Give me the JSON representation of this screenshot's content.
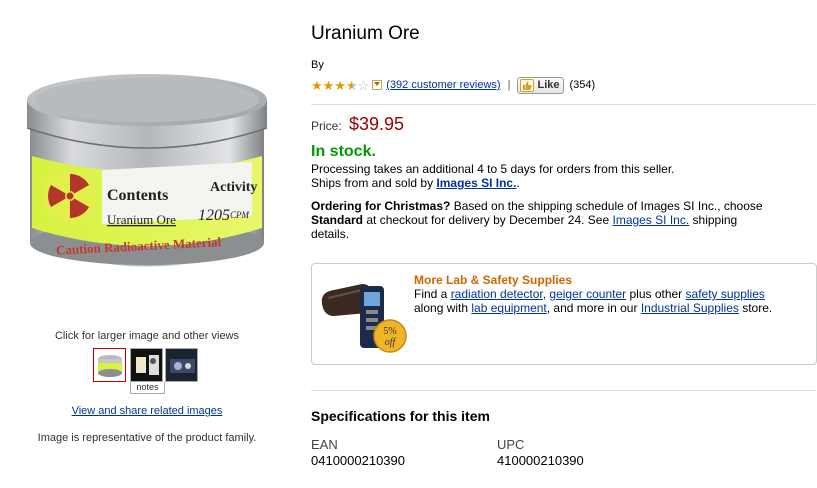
{
  "left": {
    "click_hint": "Click for larger image and other views",
    "thumbnail_note": "notes",
    "view_share": "View and share related images",
    "representative": "Image is representative of the product family.",
    "tin_label": {
      "contents": "Contents",
      "activity": "Activity",
      "item": "Uranium Ore",
      "cpm": "1205",
      "cpm_unit": "CPM",
      "caution": "Caution Radioactive Material"
    }
  },
  "product": {
    "title": "Uranium Ore",
    "by": "By",
    "rating_stars": 3.5,
    "reviews_link": "(392 customer reviews)",
    "separator": "|",
    "like_label": "Like",
    "like_count": "(354)",
    "price_label": "Price:",
    "price_value": "$39.95",
    "stock": "In stock.",
    "processing": "Processing takes an additional 4 to 5 days for orders from this seller.",
    "ships_prefix": "Ships from and sold by ",
    "seller": "Images SI Inc.",
    "ships_suffix": ".",
    "christmas_label": "Ordering for Christmas?",
    "christmas_text1": " Based on the shipping schedule of Images SI Inc., choose",
    "standard_label": "Standard",
    "christmas_text2": " at checkout for delivery by December 24. See ",
    "christmas_seller": "Images SI Inc.",
    "christmas_text3": " shipping",
    "christmas_text4": "details."
  },
  "promo": {
    "title": "More Lab & Safety Supplies",
    "text1": "Find a ",
    "link1": "radiation detector",
    "text2": ", ",
    "link2": "geiger counter",
    "text3": " plus other ",
    "link3": "safety supplies",
    "text4": "along with ",
    "link4": "lab equipment",
    "text5": ", and more in our ",
    "link5": "Industrial Supplies",
    "text6": " store.",
    "badge_percent": "5%",
    "badge_off": "off"
  },
  "specs": {
    "title": "Specifications for this item",
    "items": [
      {
        "label": "EAN",
        "value": "0410000210390"
      },
      {
        "label": "UPC",
        "value": "410000210390"
      }
    ]
  },
  "colors": {
    "price": "#990000",
    "in_stock": "#009900",
    "link": "#003399",
    "promo_title": "#cc6600",
    "star": "#e59800"
  }
}
